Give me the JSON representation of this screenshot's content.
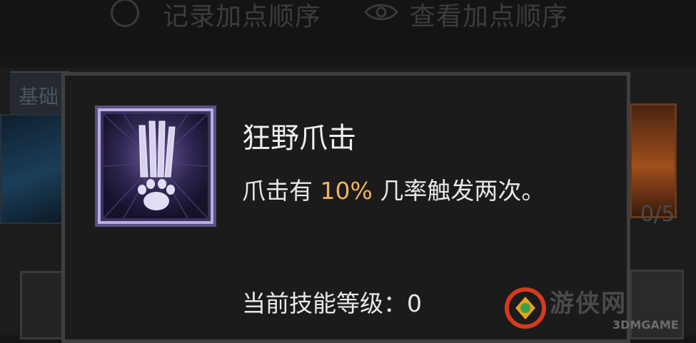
{
  "topbar": {
    "record_order_label": "记录加点顺序",
    "view_order_label": "查看加点顺序"
  },
  "tabs": {
    "basic_label": "基础"
  },
  "side_tiles": {
    "right_count": "0/5"
  },
  "tooltip": {
    "skill_name": "狂野爪击",
    "desc_prefix": "爪击有",
    "desc_value": "10%",
    "desc_suffix": "几率触发两次。",
    "level_label": "当前技能等级：",
    "level_value": "0"
  },
  "watermark": {
    "site_text": "游侠网",
    "brand_text": "3DMGAME"
  },
  "colors": {
    "highlight": "#f3b35e",
    "tooltip_border": "#3f3f3f",
    "icon_border": "#8a78b8"
  },
  "icons": [
    "radio-icon",
    "eye-icon",
    "skill-claw-icon",
    "watermark-logo-icon"
  ]
}
